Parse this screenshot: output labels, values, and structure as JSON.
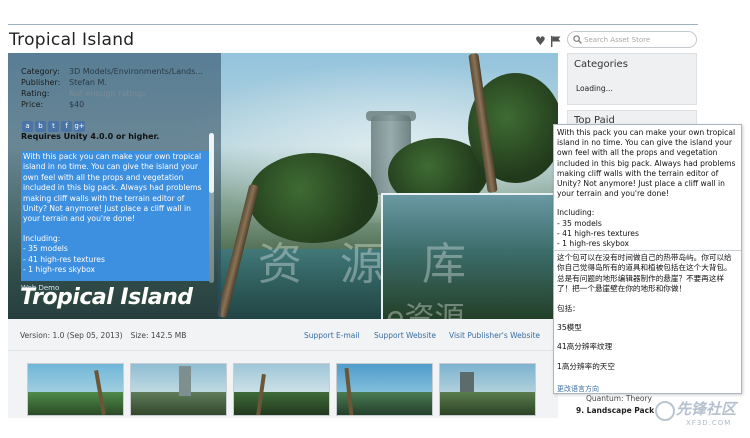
{
  "page": {
    "title": "Tropical Island"
  },
  "search": {
    "placeholder": "Search Asset Store"
  },
  "icons": {
    "favorite": "heart-icon",
    "report": "flag-icon",
    "search": "search-icon"
  },
  "info": {
    "category_label": "Category:",
    "category_value": "3D Models/Environments/Lands...",
    "publisher_label": "Publisher:",
    "publisher_value": "Stefan M.",
    "rating_label": "Rating:",
    "rating_value": "Not enough ratings",
    "price_label": "Price:",
    "price_value": "$40",
    "social": [
      "a",
      "b",
      "t",
      "f",
      "g+"
    ],
    "requires": "Requires Unity 4.0.0 or higher.",
    "description": "With this pack you can make your own tropical island in no time. You can give the island your own feel with all the props and vegetation included in this big pack. Always had problems making cliff walls with the terrain editor of Unity? Not anymore! Just place a cliff wall in your terrain and you're done!",
    "including_label": "Including:",
    "including": [
      "- 35 models",
      "- 41 high-res textures",
      "- 1 high-res skybox"
    ],
    "web_demo": "Web Demo",
    "logo_text": "Tropical Island"
  },
  "hero": {
    "watermark": "资 源 库",
    "watermark2": "e资源"
  },
  "version": {
    "version": "Version: 1.0 (Sep 05, 2013)",
    "size": "Size: 142.5 MB",
    "support_email": "Support E-mail",
    "support_website": "Support Website",
    "publisher_website": "Visit Publisher's Website"
  },
  "thumbnails": [
    "thumb-1",
    "thumb-2",
    "thumb-3",
    "thumb-4",
    "thumb-5"
  ],
  "sidebar": {
    "categories_heading": "Categories",
    "categories_loading": "Loading...",
    "top_paid_heading": "Top Paid"
  },
  "translation_popup": {
    "en_text": "With this pack you can make your own tropical island in no time. You can give the island your own feel with all the props and vegetation included in this big pack. Always had problems making cliff walls with the terrain editor of Unity? Not anymore! Just place a cliff wall in your terrain and you're done!",
    "en_including_label": "Including:",
    "en_including": [
      "- 35 models",
      "- 41 high-res textures",
      "- 1 high-res skybox"
    ],
    "zh_text": "这个包可以在没有时间做自己的热带岛屿。你可以给你自己觉得岛所有的道具和植被包括在这个大背包。总是有问题的地形编辑器制作的悬崖？不要再这样了！把一个悬崖壁在你的地形和你做！",
    "zh_including_label": "包括：",
    "zh_items": [
      "35模型",
      "41高分辨率纹理",
      "1高分辨率的天空"
    ],
    "change_language": "更改语言方向"
  },
  "below_popup": {
    "item_quantum": "Quantum: Theory",
    "item_landscape": "9. Landscape Pack"
  },
  "corner_watermark": {
    "text": "先锋社区",
    "url_text": "XF3D.COM"
  },
  "colors": {
    "accent_blue": "#3d8fe0",
    "link": "#3a6ea5",
    "panel_bg": "#eef0f1"
  }
}
